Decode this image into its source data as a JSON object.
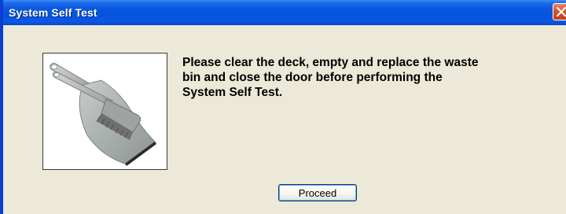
{
  "window": {
    "title": "System Self Test",
    "close_icon": "close-icon"
  },
  "dialog": {
    "image_icon": "dustpan-and-brush",
    "message_lines": [
      "Please clear the deck, empty and replace the waste",
      "bin and close the door before performing the",
      "System Self Test."
    ],
    "proceed_label": "Proceed"
  },
  "colors": {
    "titlebar": "#0553dc",
    "window_background": "#ece9d8",
    "close_button": "#d6512f"
  }
}
